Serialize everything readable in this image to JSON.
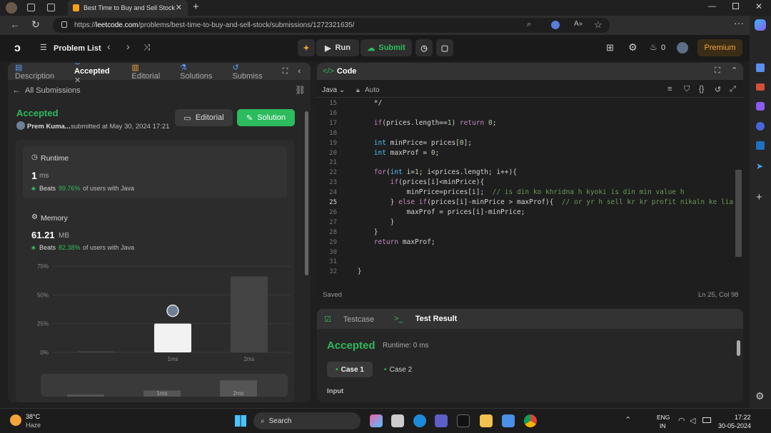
{
  "browser": {
    "tab_title": "Best Time to Buy and Sell Stock",
    "url_prefix": "https://",
    "url_host": "leetcode.com",
    "url_path": "/problems/best-time-to-buy-and-sell-stock/submissions/1272321635/"
  },
  "header": {
    "problem_list": "Problem List",
    "run": "Run",
    "submit": "Submit",
    "streak": "0",
    "premium": "Premium"
  },
  "left_tabs": [
    "Description",
    "Accepted",
    "Editorial",
    "Solutions",
    "Submiss"
  ],
  "submission": {
    "back": "All Submissions",
    "status": "Accepted",
    "user": "Prem Kuma...",
    "submitted": "submitted at May 30, 2024 17:21",
    "editorial_btn": "Editorial",
    "solution_btn": "Solution"
  },
  "runtime": {
    "label": "Runtime",
    "value": "1",
    "unit": "ms",
    "beats_label": "Beats",
    "beats": "99.76%",
    "suffix": "of users with Java"
  },
  "memory": {
    "label": "Memory",
    "value": "61.21",
    "unit": "MB",
    "beats_label": "Beats",
    "beats": "82.38%",
    "suffix": "of users with Java"
  },
  "chart_data": {
    "type": "bar",
    "yticks": [
      "75%",
      "50%",
      "25%",
      "0%"
    ],
    "categories": [
      "",
      "1ms",
      "2ms"
    ],
    "values": [
      1,
      25,
      66
    ],
    "highlight": "1ms",
    "ylim": [
      0,
      75
    ],
    "mini_labels": [
      "1ms",
      "2ms"
    ]
  },
  "code_panel": {
    "title": "Code",
    "language": "Java",
    "mode": "Auto",
    "status": "Saved",
    "cursor": "Ln 25, Col 98"
  },
  "code_lines": [
    {
      "n": "15",
      "t": "        */"
    },
    {
      "n": "16",
      "t": ""
    },
    {
      "n": "17",
      "t": "        if(prices.length==1) return 0;"
    },
    {
      "n": "18",
      "t": ""
    },
    {
      "n": "19",
      "t": "        int minPrice= prices[0];"
    },
    {
      "n": "20",
      "t": "        int maxProf = 0;"
    },
    {
      "n": "21",
      "t": ""
    },
    {
      "n": "22",
      "t": "        for(int i=1; i<prices.length; i++){"
    },
    {
      "n": "23",
      "t": "            if(prices[i]<minPrice){"
    },
    {
      "n": "24",
      "t": "                minPrice=prices[i];  // is din ko khridna h kyoki is din min value h"
    },
    {
      "n": "25",
      "t": "            } else if(prices[i]-minPrice > maxProf){  // or yr h sell kr kr profit nikaln ke lia"
    },
    {
      "n": "26",
      "t": "                maxProf = prices[i]-minPrice;"
    },
    {
      "n": "27",
      "t": "            }"
    },
    {
      "n": "28",
      "t": "        }"
    },
    {
      "n": "29",
      "t": "        return maxProf;"
    },
    {
      "n": "30",
      "t": ""
    },
    {
      "n": "31",
      "t": ""
    },
    {
      "n": "32",
      "t": "    }"
    }
  ],
  "result": {
    "tab_testcase": "Testcase",
    "tab_result": "Test Result",
    "status": "Accepted",
    "runtime": "Runtime: 0 ms",
    "case1": "Case 1",
    "case2": "Case 2",
    "input_label": "Input"
  },
  "taskbar": {
    "temp": "38°C",
    "weather": "Haze",
    "search": "Search",
    "lang1": "ENG",
    "lang2": "IN",
    "time": "17:22",
    "date": "30-05-2024"
  }
}
